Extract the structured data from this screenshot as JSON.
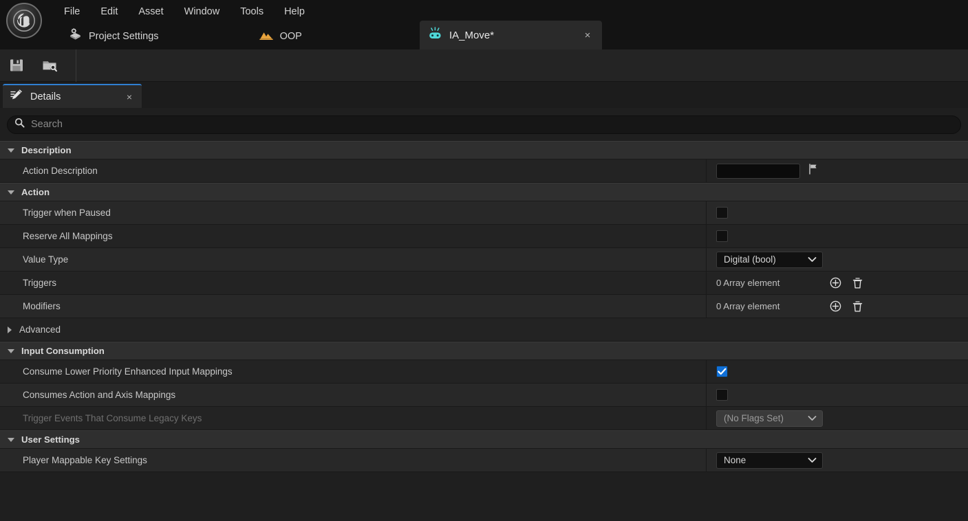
{
  "app": {
    "logo_icon": "unreal-engine-logo"
  },
  "menubar": {
    "items": [
      {
        "label": "File"
      },
      {
        "label": "Edit"
      },
      {
        "label": "Asset"
      },
      {
        "label": "Window"
      },
      {
        "label": "Tools"
      },
      {
        "label": "Help"
      }
    ]
  },
  "asset_bar": {
    "project_settings": {
      "label": "Project Settings",
      "icon": "project-settings-icon"
    },
    "level": {
      "label": "OOP",
      "icon": "level-mountain-icon",
      "color": "#e8a33d"
    }
  },
  "document_tab": {
    "label": "IA_Move*",
    "icon": "input-action-gamepad-icon",
    "icon_color": "#4fd8d8",
    "close_label": "×"
  },
  "toolbar": {
    "save": {
      "label": "Save",
      "icon": "save-floppy-icon"
    },
    "browse": {
      "label": "Browse",
      "icon": "browse-folder-search-icon"
    }
  },
  "details_panel": {
    "tab_label": "Details",
    "tab_icon": "details-pencil-icon",
    "close_label": "×",
    "accent_color": "#2f7fd1",
    "search": {
      "placeholder": "Search",
      "value": "",
      "icon": "search-icon"
    }
  },
  "properties": {
    "sections": [
      {
        "name": "Description",
        "expanded": true,
        "rows": [
          {
            "label": "Action Description",
            "widget": "text-with-flag",
            "value": "",
            "flag_icon": "localization-flag-icon",
            "disabled": false
          }
        ]
      },
      {
        "name": "Action",
        "expanded": true,
        "rows": [
          {
            "label": "Trigger when Paused",
            "widget": "checkbox",
            "checked": false,
            "disabled": false
          },
          {
            "label": "Reserve All Mappings",
            "widget": "checkbox",
            "checked": false,
            "disabled": false
          },
          {
            "label": "Value Type",
            "widget": "combo",
            "value": "Digital (bool)",
            "disabled": false
          },
          {
            "label": "Triggers",
            "widget": "array",
            "value": "0 Array element",
            "add_icon": "plus-circle-icon",
            "delete_icon": "trash-icon",
            "disabled": false
          },
          {
            "label": "Modifiers",
            "widget": "array",
            "value": "0 Array element",
            "add_icon": "plus-circle-icon",
            "delete_icon": "trash-icon",
            "disabled": false
          }
        ]
      },
      {
        "name": "Advanced",
        "expanded": false,
        "rows": []
      },
      {
        "name": "Input Consumption",
        "expanded": true,
        "rows": [
          {
            "label": "Consume Lower Priority Enhanced Input Mappings",
            "widget": "checkbox",
            "checked": true,
            "disabled": false
          },
          {
            "label": "Consumes Action and Axis Mappings",
            "widget": "checkbox",
            "checked": false,
            "disabled": false
          },
          {
            "label": "Trigger Events That Consume Legacy Keys",
            "widget": "combo",
            "value": "(No Flags Set)",
            "disabled": true
          }
        ]
      },
      {
        "name": "User Settings",
        "expanded": true,
        "rows": [
          {
            "label": "Player Mappable Key Settings",
            "widget": "combo",
            "value": "None",
            "disabled": false
          }
        ]
      }
    ]
  }
}
